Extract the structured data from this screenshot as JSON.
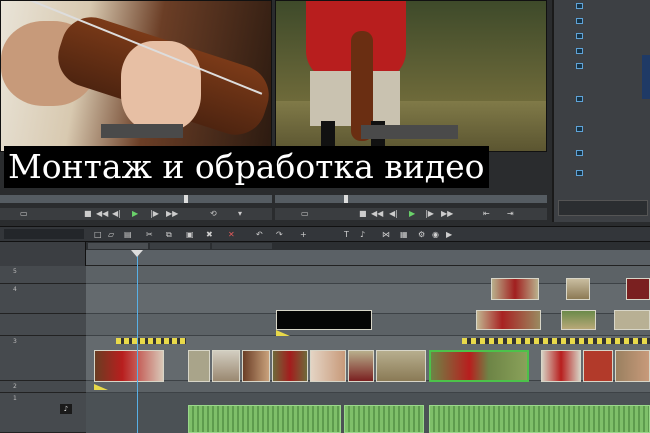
{
  "title": "Монтаж и обработка видео",
  "accent_color": "#4cc24a",
  "playhead_color": "#58b0e6",
  "track_numbers": [
    "5",
    "4",
    "3",
    "2",
    "1"
  ],
  "icons": {
    "play": "play-icon",
    "rewind": "rewind-icon",
    "forward": "forward-icon",
    "speaker": "speaker-icon"
  }
}
